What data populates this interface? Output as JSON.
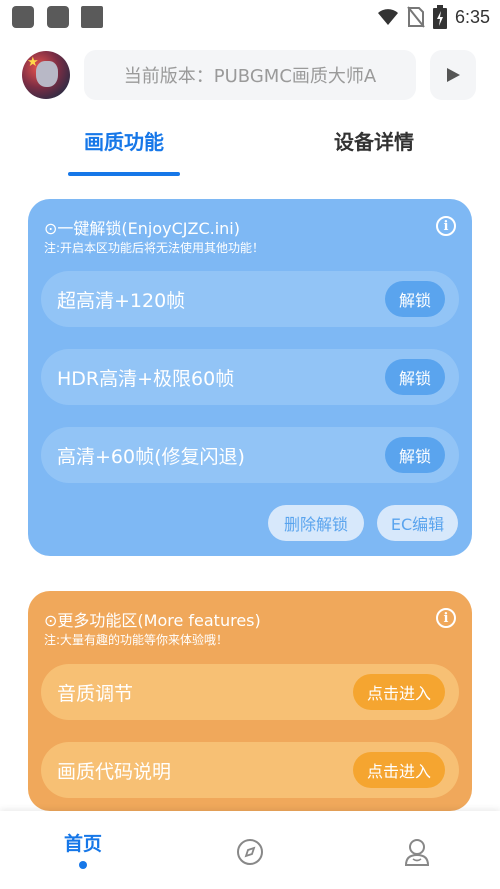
{
  "status_bar": {
    "time": "6:35"
  },
  "header": {
    "version_text": "当前版本：PUBGMC画质大师A"
  },
  "tabs": [
    {
      "label": "画质功能"
    },
    {
      "label": "设备详情"
    }
  ],
  "unlock_card": {
    "title": "⊙一键解锁(EnjoyCJZC.ini)",
    "subtitle": "注:开启本区功能后将无法使用其他功能！",
    "rows": [
      {
        "label": "超高清+120帧",
        "button": "解锁"
      },
      {
        "label": "HDR高清+极限60帧",
        "button": "解锁"
      },
      {
        "label": "高清+60帧(修复闪退)",
        "button": "解锁"
      }
    ],
    "delete_label": "删除解锁",
    "edit_label": "EC编辑"
  },
  "features_card": {
    "title": "⊙更多功能区(More features)",
    "subtitle": "注:大量有趣的功能等你来体验哦！",
    "rows": [
      {
        "label": "音质调节",
        "button": "点击进入"
      },
      {
        "label": "画质代码说明",
        "button": "点击进入"
      }
    ]
  },
  "bottom_nav": {
    "home_label": "首页"
  },
  "colors": {
    "accent": "#1677e8",
    "blue_card": "#7eb8f4",
    "orange_card": "#f0a85b"
  },
  "icons": [
    "wifi-icon",
    "no-sim-icon",
    "battery-icon",
    "play-icon",
    "info-icon",
    "compass-icon",
    "user-icon"
  ]
}
